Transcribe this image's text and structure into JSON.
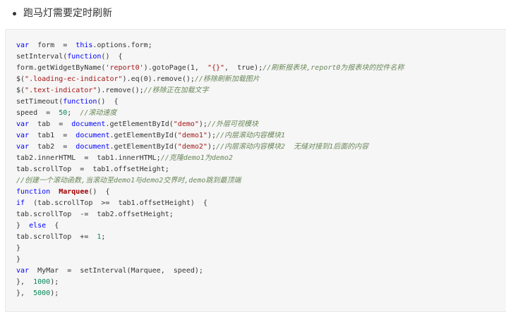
{
  "heading": {
    "text": "跑马灯需要定时刷新"
  },
  "code": {
    "lines": [
      [
        {
          "t": "var",
          "c": "kw"
        },
        {
          "t": "  form  =  "
        },
        {
          "t": "this",
          "c": "kw"
        },
        {
          "t": ".options.form;"
        }
      ],
      [
        {
          "t": "setInterval("
        },
        {
          "t": "function",
          "c": "kw"
        },
        {
          "t": "()  {"
        }
      ],
      [
        {
          "t": "form.getWidgetByName("
        },
        {
          "t": "'report0'",
          "c": "str"
        },
        {
          "t": ").gotoPage(1,  "
        },
        {
          "t": "\"{}\"",
          "c": "str"
        },
        {
          "t": ",  true);"
        },
        {
          "t": "//刷新报表块,report0为报表块的控件名称",
          "c": "cmt"
        }
      ],
      [
        {
          "t": "$("
        },
        {
          "t": "\".loading-ec-indicator\"",
          "c": "str"
        },
        {
          "t": ").eq(0).remove();"
        },
        {
          "t": "//移除刷新加载图片",
          "c": "cmt"
        }
      ],
      [
        {
          "t": "$("
        },
        {
          "t": "\".text-indicator\"",
          "c": "str"
        },
        {
          "t": ").remove();"
        },
        {
          "t": "//移除正在加载文字",
          "c": "cmt"
        }
      ],
      [
        {
          "t": "setTimeout("
        },
        {
          "t": "function",
          "c": "kw"
        },
        {
          "t": "()  {"
        }
      ],
      [
        {
          "t": "speed  =  "
        },
        {
          "t": "50",
          "c": "num"
        },
        {
          "t": ";  "
        },
        {
          "t": "//滚动速度",
          "c": "cmt"
        }
      ],
      [
        {
          "t": "var",
          "c": "kw"
        },
        {
          "t": "  tab  =  "
        },
        {
          "t": "document",
          "c": "kw"
        },
        {
          "t": ".getElementById("
        },
        {
          "t": "\"demo\"",
          "c": "str"
        },
        {
          "t": ");"
        },
        {
          "t": "//外层可视模块",
          "c": "cmt"
        }
      ],
      [
        {
          "t": "var",
          "c": "kw"
        },
        {
          "t": "  tab1  =  "
        },
        {
          "t": "document",
          "c": "kw"
        },
        {
          "t": ".getElementById("
        },
        {
          "t": "\"demo1\"",
          "c": "str"
        },
        {
          "t": ");"
        },
        {
          "t": "//内层滚动内容模块1",
          "c": "cmt"
        }
      ],
      [
        {
          "t": "var",
          "c": "kw"
        },
        {
          "t": "  tab2  =  "
        },
        {
          "t": "document",
          "c": "kw"
        },
        {
          "t": ".getElementById("
        },
        {
          "t": "\"demo2\"",
          "c": "str"
        },
        {
          "t": ");"
        },
        {
          "t": "//内层滚动内容模块2  无缝对接到1后面的内容",
          "c": "cmt"
        }
      ],
      [
        {
          "t": "tab2.innerHTML  =  tab1.innerHTML;"
        },
        {
          "t": "//克隆demo1为demo2",
          "c": "cmt"
        }
      ],
      [
        {
          "t": "tab.scrollTop  =  tab1.offsetHeight;"
        }
      ],
      [
        {
          "t": "//创建一个滚动函数,当滚动至demo1与demo2交界时,demo跳到最顶端",
          "c": "cmt"
        }
      ],
      [
        {
          "t": "function",
          "c": "kw"
        },
        {
          "t": "  "
        },
        {
          "t": "Marquee",
          "c": "fn"
        },
        {
          "t": "()  {"
        }
      ],
      [
        {
          "t": "if",
          "c": "kw"
        },
        {
          "t": "  (tab.scrollTop  >=  tab1.offsetHeight)  {"
        }
      ],
      [
        {
          "t": "tab.scrollTop  -=  tab2.offsetHeight;"
        }
      ],
      [
        {
          "t": "}  "
        },
        {
          "t": "else",
          "c": "kw"
        },
        {
          "t": "  {"
        }
      ],
      [
        {
          "t": "tab.scrollTop  +=  "
        },
        {
          "t": "1",
          "c": "num"
        },
        {
          "t": ";"
        }
      ],
      [
        {
          "t": "}"
        }
      ],
      [
        {
          "t": "}"
        }
      ],
      [
        {
          "t": "var",
          "c": "kw"
        },
        {
          "t": "  MyMar  =  setInterval(Marquee,  speed);"
        }
      ],
      [
        {
          "t": "},  "
        },
        {
          "t": "1000",
          "c": "num"
        },
        {
          "t": ");"
        }
      ],
      [
        {
          "t": "},  "
        },
        {
          "t": "5000",
          "c": "num"
        },
        {
          "t": ");"
        }
      ]
    ]
  }
}
